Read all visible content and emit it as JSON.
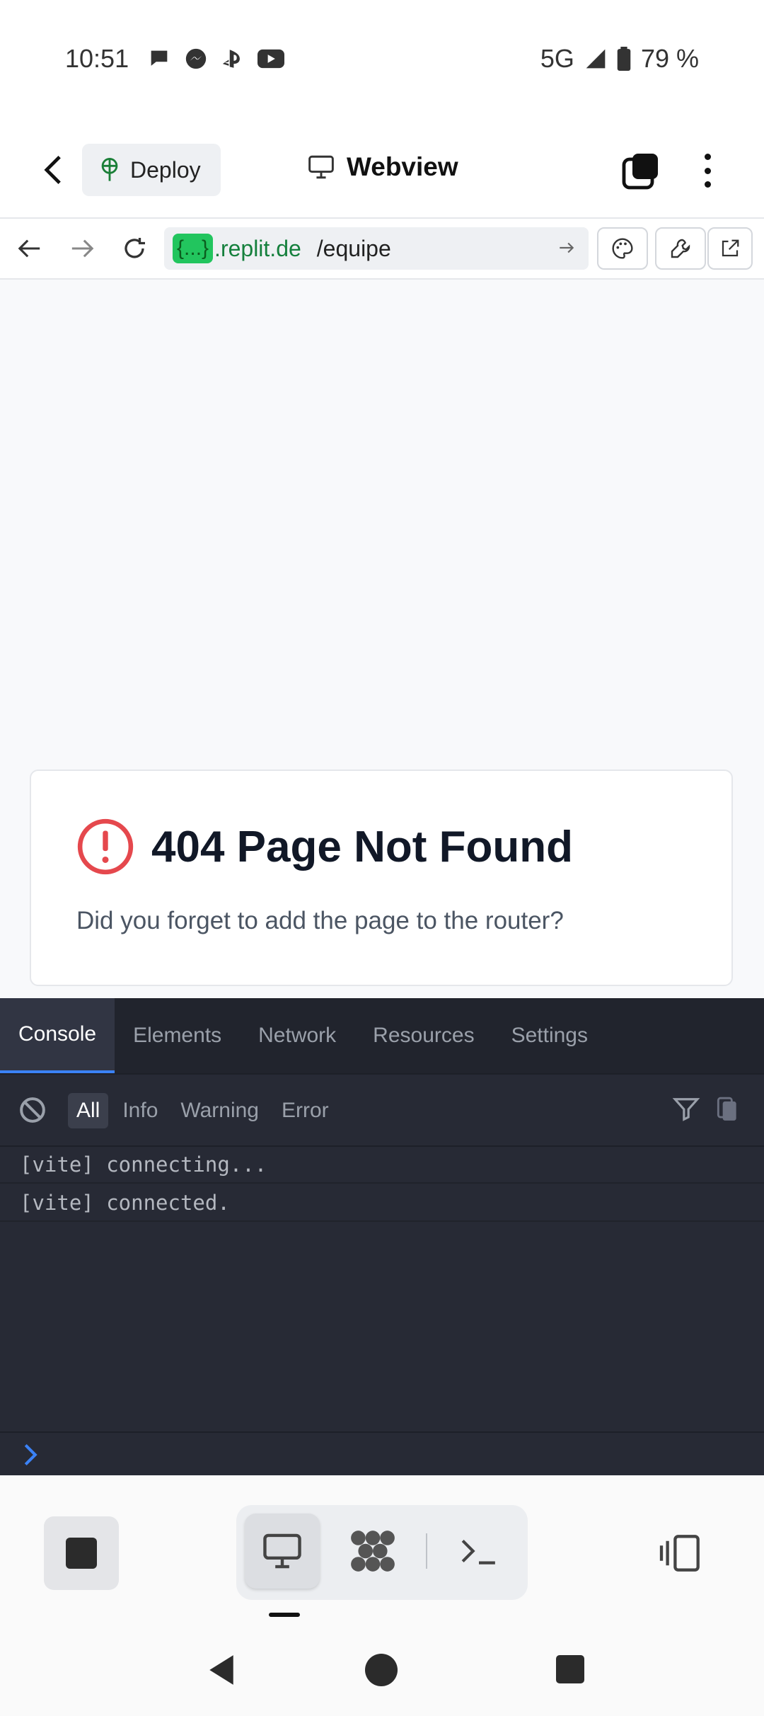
{
  "status_bar": {
    "time": "10:51",
    "network": "5G",
    "battery": "79 %",
    "notification_icons": [
      "chat-bubble-icon",
      "messenger-icon",
      "playstation-icon",
      "youtube-icon"
    ]
  },
  "app_bar": {
    "deploy_label": "Deploy",
    "title": "Webview"
  },
  "url_bar": {
    "tag": "{...}",
    "domain": ".replit.de",
    "path": "/equipe"
  },
  "page": {
    "error_title": "404 Page Not Found",
    "error_message": "Did you forget to add the page to the router?"
  },
  "devtools": {
    "tabs": [
      {
        "label": "Console",
        "active": true
      },
      {
        "label": "Elements",
        "active": false
      },
      {
        "label": "Network",
        "active": false
      },
      {
        "label": "Resources",
        "active": false
      },
      {
        "label": "Settings",
        "active": false
      }
    ],
    "filters": [
      {
        "label": "All",
        "active": true
      },
      {
        "label": "Info",
        "active": false
      },
      {
        "label": "Warning",
        "active": false
      },
      {
        "label": "Error",
        "active": false
      }
    ],
    "logs": [
      "[vite] connecting...",
      "[vite] connected."
    ]
  },
  "colors": {
    "accent": "#3b82f6",
    "error_icon": "#e5484d",
    "url_tag": "#22c55e",
    "devtools_bg": "#272a35"
  }
}
